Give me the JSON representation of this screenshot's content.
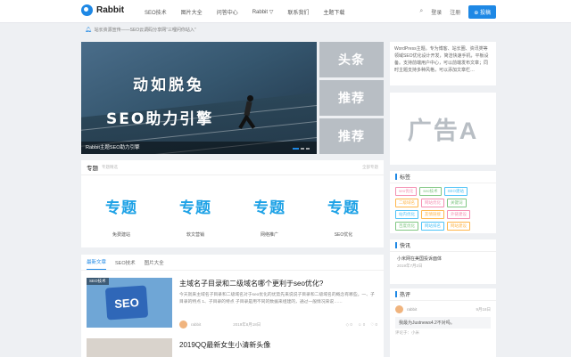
{
  "header": {
    "logo_text": "Rabbit",
    "nav": [
      "SEO技术",
      "图片大全",
      "问答中心",
      "Rabbit ▽",
      "联系我们",
      "主题下载"
    ],
    "login": "登录",
    "register": "注册",
    "post_button": "⊕ 投稿"
  },
  "notice": {
    "text": "站长资源宣传——SEO云调码分享网“三哩问你站入”"
  },
  "slider": {
    "line1": "动如脱兔",
    "line2": "SEO助力引擎",
    "caption": "Rabbit主题SEO助力引擎"
  },
  "tiles": [
    "头条",
    "推荐",
    "推荐"
  ],
  "sidebar": {
    "intro": "WordPress主题。专为博客、站长圈、资讯类等领域SEO优化设计开发，简洁快速手机，平板设备。支持前端用户中心，可以前端发布文章；同时主题支持多种风格，可以添加文章栏…",
    "ad_text": "广告A",
    "tags_title": "标签",
    "tags": [
      {
        "label": "seo优化",
        "color": "#f48fb1"
      },
      {
        "label": "seo技术",
        "color": "#81c784"
      },
      {
        "label": "SEO建站",
        "color": "#4fc3f7"
      },
      {
        "label": "二级域名",
        "color": "#ffb74d"
      },
      {
        "label": "网站优化",
        "color": "#f48fb1"
      },
      {
        "label": "关键词",
        "color": "#81c784"
      },
      {
        "label": "站内优化",
        "color": "#4fc3f7"
      },
      {
        "label": "友情链接",
        "color": "#ffb74d"
      },
      {
        "label": "外链建设",
        "color": "#f48fb1"
      },
      {
        "label": "百度优化",
        "color": "#81c784"
      },
      {
        "label": "网站排名",
        "color": "#4fc3f7"
      },
      {
        "label": "网站建设",
        "color": "#ffb74d"
      }
    ],
    "news_title": "快讯",
    "news_item": "小米网在美国投诉面体",
    "news_date": "2019年7月2日",
    "comments_title": "热评",
    "comment_name": "rabbit",
    "comment_time": "9月18日",
    "comment_text": "我最为Justnews4.2不对吗。",
    "comment_post": "评论于：小米"
  },
  "topics": {
    "title": "专题",
    "subtitle": "专题精选",
    "more": "全部专题",
    "items": [
      {
        "img_text": "专题",
        "label": "免费建站"
      },
      {
        "img_text": "专题",
        "label": "软文营销"
      },
      {
        "img_text": "专题",
        "label": "网络推广"
      },
      {
        "img_text": "专题",
        "label": "SEO优化"
      }
    ]
  },
  "articles": {
    "tabs": [
      "最新文章",
      "SEO技术",
      "图片大全"
    ],
    "first": {
      "badge": "SEO技术",
      "thumb_text": "SEO",
      "title": "主域名子目录和二级域名哪个更利于seo优化?",
      "excerpt": "今天就来主域名子目录和二级域名对于seo优化的优势先来说说子目录和二级域名的概念有哪些。一、子目录的特点 1、子目录的特点 子目录是用不同的数据来组建的，通过一般情况来说……",
      "author": "rabbit",
      "date": "2019年8月18日",
      "stats": [
        "◇ 0",
        "☺ 0",
        "♡ 0"
      ]
    },
    "second_title": "2019QQ最新女生小清新头像"
  }
}
